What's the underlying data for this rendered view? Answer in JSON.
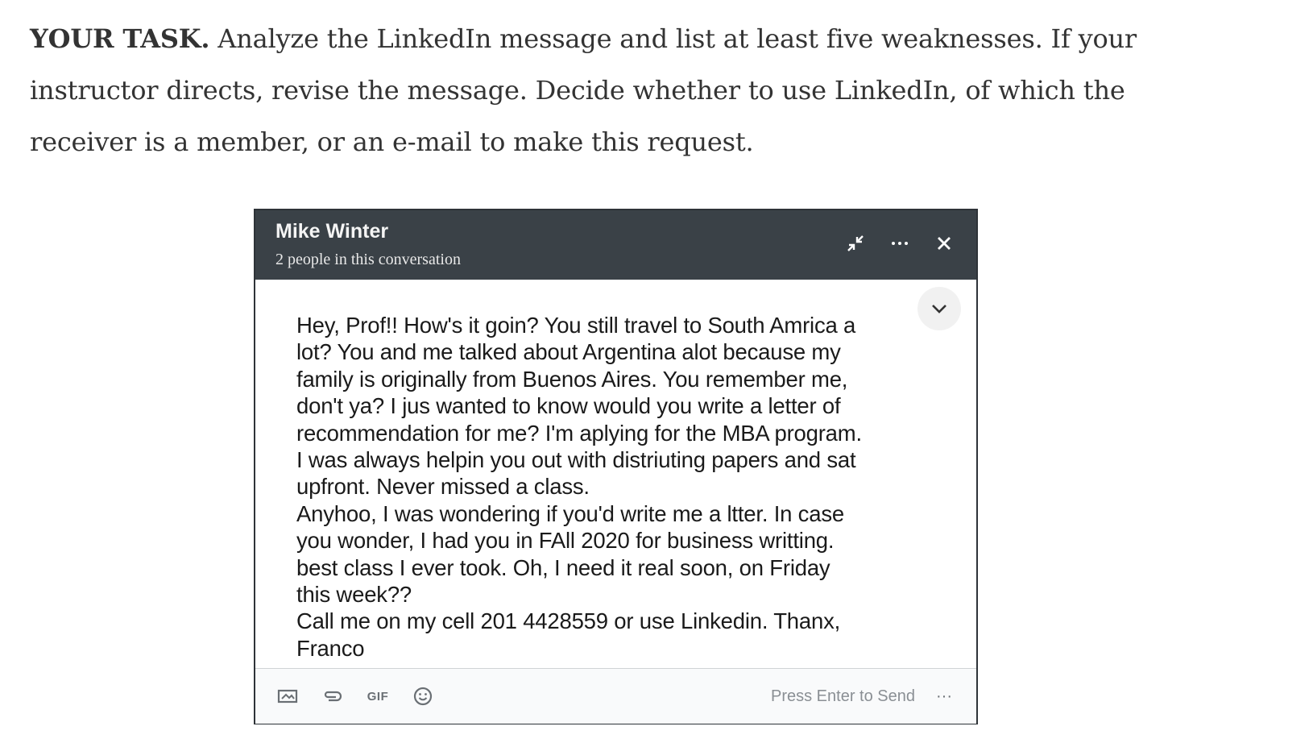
{
  "task": {
    "label": "YOUR TASK.",
    "text": " Analyze the LinkedIn message and list at least five weaknesses. If your instructor directs, revise the message. Decide whether to use LinkedIn, of which the receiver is a member, or an e-mail to make this request."
  },
  "window": {
    "sender_name": "Mike Winter",
    "conversation_count": "2 people in this conversation",
    "icons": {
      "minimize": "minimize-icon",
      "more": "more-options-icon",
      "close": "close-icon",
      "collapse": "chevron-down-icon"
    }
  },
  "message": {
    "lines": [
      "Hey, Prof!! How's it goin? You still travel to South Amrica a",
      "lot? You and me talked about Argentina alot because my",
      "family is originally from Buenos Aires. You remember me,",
      "don't ya? I jus wanted to know would you write a letter of",
      "recommendation for me? I'm aplying for the MBA program.",
      "I was always helpin you out with distriuting papers and sat",
      "upfront. Never missed a class.",
      "Anyhoo, I was wondering if you'd write me a ltter. In case",
      "you wonder, I had you in FAll 2020 for business writting.",
      "best class I ever took. Oh, I need it real soon, on Friday",
      "this week??",
      "Call me on my cell 201 4428559 or use Linkedin. Thanx,",
      "Franco"
    ]
  },
  "footer": {
    "gif_label": "GIF",
    "send_hint": "Press Enter to Send",
    "more_label": "···",
    "icons": {
      "image": "image-icon",
      "attach": "attachment-icon",
      "gif": "gif-icon",
      "emoji": "emoji-icon",
      "more": "more-options-icon"
    }
  },
  "colors": {
    "header_bg": "#3a4147",
    "footer_bg": "#f9fafb",
    "body_text": "#1a1a1a"
  }
}
